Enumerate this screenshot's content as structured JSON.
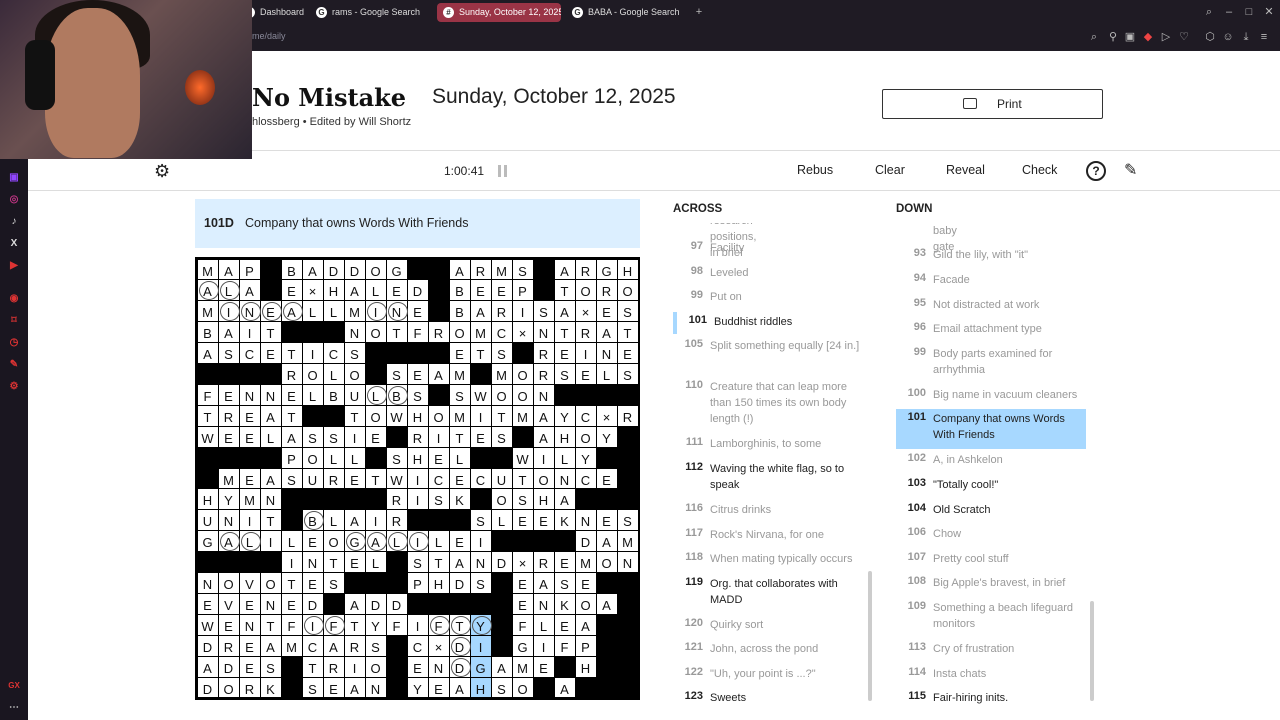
{
  "browser": {
    "tabs": [
      {
        "label": "Dashboard",
        "icon": "dashboard-icon",
        "active": false
      },
      {
        "label": "rams - Google Search",
        "icon": "google-icon",
        "active": false
      },
      {
        "label": "Sunday, October 12, 2025",
        "icon": "nyt-icon",
        "active": true
      },
      {
        "label": "BABA - Google Search",
        "icon": "google-icon",
        "active": false
      }
    ],
    "url": "me/daily"
  },
  "puzzle": {
    "title": "No Mistake",
    "date": "Sunday, October 12, 2025",
    "byline": "hlossberg  •  Edited by Will Shortz",
    "print_label": "Print"
  },
  "toolbar": {
    "timer": "1:00:41",
    "rebus": "Rebus",
    "clear": "Clear",
    "reveal": "Reveal",
    "check": "Check",
    "help": "?"
  },
  "current_clue": {
    "number": "101D",
    "text": "Company that owns Words With Friends"
  },
  "grid": {
    "rows": [
      "MAP#BADDOG##ARMS#ARGH",
      "ALA#EXHALED#BEEP#TORO",
      "MINEALLMINE#BARISAXES",
      "BAIT###NOTFROMCXNTRATE",
      "ASCETICS####ETS#REINER",
      "####ROLO#SEAM#MORSELS#",
      "FENNEL BULBS#SWOON####",
      "TREAT##TOWHOMITMAYCXRN",
      "WEELASSIE#RITES#AHOY",
      "####POLL#SHEL##WILY",
      "#MEASURETWICECUTONCE#",
      "HYMN#####RISK#OSHA###",
      "UNIT#BLAIR###SLEEKNESS",
      "GALILEOGALILEI####DAMUP",
      "####INTEL#STANDXREMONY",
      "NOVOTES###PHDS#EASE###",
      "EVENED#ADD#####ENKOA###",
      "WENTFIFTYFIFTY#FLEA",
      "DREAMCARS#CXDI#GIFP##",
      "ADES#TRIO#ENDGAME#H##",
      "DORK#SEAN#YEAHSO#A##"
    ]
  },
  "across": {
    "header": "ACROSS",
    "partial_top": "research positions, in brief",
    "clues": [
      {
        "n": "97",
        "t": "Facility",
        "state": "done"
      },
      {
        "n": "98",
        "t": "Leveled",
        "state": "done"
      },
      {
        "n": "99",
        "t": "Put on",
        "state": "done"
      },
      {
        "n": "101",
        "t": "Buddhist riddles",
        "state": "cross"
      },
      {
        "n": "105",
        "t": "Split something equally [24 in.]",
        "state": "done"
      },
      {
        "n": "110",
        "t": "Creature that can leap more than 150 times its own body length (!)",
        "state": "done"
      },
      {
        "n": "111",
        "t": "Lamborghinis, to some",
        "state": "done"
      },
      {
        "n": "112",
        "t": "Waving the white flag, so to speak",
        "state": "open"
      },
      {
        "n": "116",
        "t": "Citrus drinks",
        "state": "done"
      },
      {
        "n": "117",
        "t": "Rock's Nirvana, for one",
        "state": "done"
      },
      {
        "n": "118",
        "t": "When mating typically occurs",
        "state": "done"
      },
      {
        "n": "119",
        "t": "Org. that collaborates with MADD",
        "state": "open"
      },
      {
        "n": "120",
        "t": "Quirky sort",
        "state": "done"
      },
      {
        "n": "121",
        "t": "John, across the pond",
        "state": "done"
      },
      {
        "n": "122",
        "t": "\"Uh, your point is ...?\"",
        "state": "done"
      },
      {
        "n": "123",
        "t": "Sweets",
        "state": "open"
      }
    ]
  },
  "down": {
    "header": "DOWN",
    "partial_top": "baby gate",
    "clues": [
      {
        "n": "93",
        "t": "Gild the lily, with \"it\"",
        "state": "done"
      },
      {
        "n": "94",
        "t": "Facade",
        "state": "done"
      },
      {
        "n": "95",
        "t": "Not distracted at work",
        "state": "done"
      },
      {
        "n": "96",
        "t": "Email attachment type",
        "state": "done"
      },
      {
        "n": "99",
        "t": "Body parts examined for arrhythmia",
        "state": "done"
      },
      {
        "n": "100",
        "t": "Big name in vacuum cleaners",
        "state": "done"
      },
      {
        "n": "101",
        "t": "Company that owns Words With Friends",
        "state": "current"
      },
      {
        "n": "102",
        "t": "A, in Ashkelon",
        "state": "done"
      },
      {
        "n": "103",
        "t": "\"Totally cool!\"",
        "state": "open"
      },
      {
        "n": "104",
        "t": "Old Scratch",
        "state": "open"
      },
      {
        "n": "106",
        "t": "Chow",
        "state": "done"
      },
      {
        "n": "107",
        "t": "Pretty cool stuff",
        "state": "done"
      },
      {
        "n": "108",
        "t": "Big Apple's bravest, in brief",
        "state": "done"
      },
      {
        "n": "109",
        "t": "Something a beach lifeguard monitors",
        "state": "done"
      },
      {
        "n": "113",
        "t": "Cry of frustration",
        "state": "done"
      },
      {
        "n": "114",
        "t": "Insta chats",
        "state": "done"
      },
      {
        "n": "115",
        "t": "Fair-hiring inits.",
        "state": "open"
      }
    ]
  },
  "colors": {
    "selected": "#ffda00",
    "highlight": "#a7d8ff",
    "clue_bar": "#dcefff",
    "active_tab": "#9a3446"
  }
}
